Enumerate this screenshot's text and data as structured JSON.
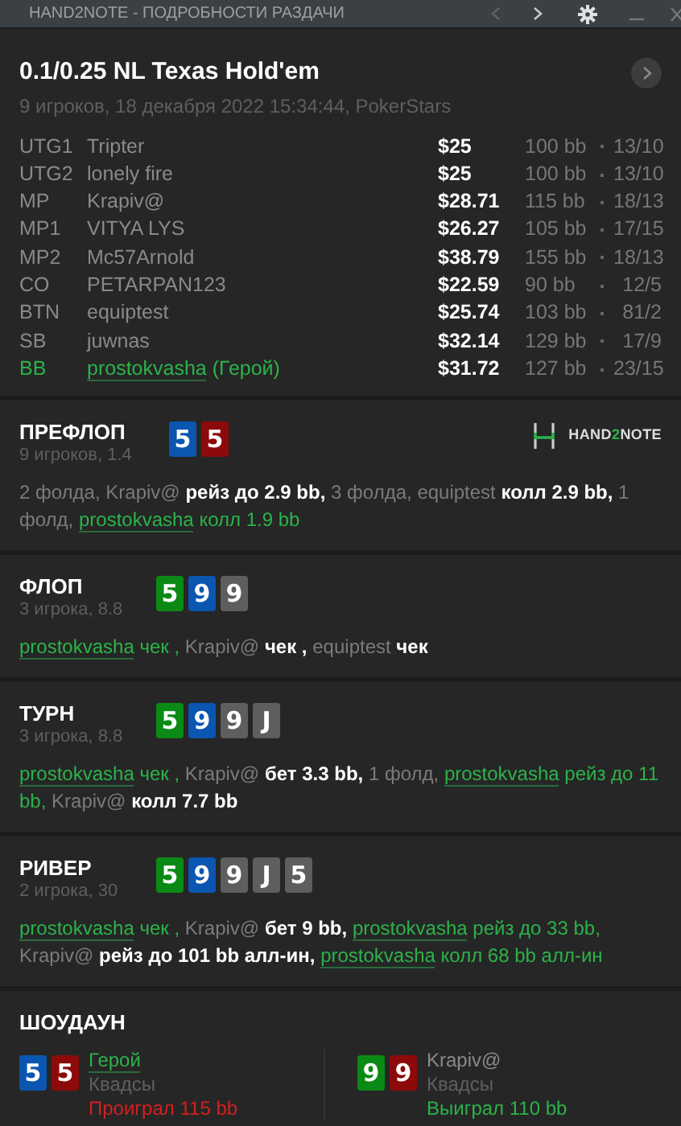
{
  "window": {
    "title": "HAND2NOTE - ПОДРОБНОСТИ РАЗДАЧИ",
    "back_disabled": true
  },
  "hand": {
    "title": "0.1/0.25 NL Texas Hold'em",
    "subtitle": "9 игроков, 18 декабря 2022 15:34:44, PokerStars"
  },
  "players": [
    {
      "position": "UTG1",
      "name": "Tripter",
      "hero": false,
      "stack": "$25",
      "bb": "100 bb",
      "stats": "13/10"
    },
    {
      "position": "UTG2",
      "name": "lonely fire",
      "hero": false,
      "stack": "$25",
      "bb": "100 bb",
      "stats": "13/10"
    },
    {
      "position": "MP",
      "name": "Krapiv@",
      "hero": false,
      "stack": "$28.71",
      "bb": "115 bb",
      "stats": "18/13"
    },
    {
      "position": "MP1",
      "name": "VITYA LYS",
      "hero": false,
      "stack": "$26.27",
      "bb": "105 bb",
      "stats": "17/15"
    },
    {
      "position": "MP2",
      "name": "Mc57Arnold",
      "hero": false,
      "stack": "$38.79",
      "bb": "155 bb",
      "stats": "18/13"
    },
    {
      "position": "CO",
      "name": "PETARPAN123",
      "hero": false,
      "stack": "$22.59",
      "bb": "90 bb",
      "stats": "12/5"
    },
    {
      "position": "BTN",
      "name": "equiptest",
      "hero": false,
      "stack": "$25.74",
      "bb": "103 bb",
      "stats": "81/2"
    },
    {
      "position": "SB",
      "name": "juwnas",
      "hero": false,
      "stack": "$32.14",
      "bb": "129 bb",
      "stats": "17/9"
    },
    {
      "position": "BB",
      "name": "prostokvasha",
      "hero": true,
      "hero_label": "(Герой)",
      "stack": "$31.72",
      "bb": "127 bb",
      "stats": "23/15"
    }
  ],
  "logo": {
    "text_a": "HAND",
    "text_b": "2",
    "text_c": "NOTE"
  },
  "streets": [
    {
      "name": "ПРЕФЛОП",
      "info": "9 игроков, 1.4",
      "cards": [
        {
          "rank": "5",
          "color": "#0b56b0"
        },
        {
          "rank": "5",
          "color": "#8c0a0a"
        }
      ],
      "actions": [
        {
          "kind": "plain",
          "text": "2 фолда,"
        },
        {
          "kind": "name",
          "text": "Krapiv@"
        },
        {
          "kind": "act",
          "text": "рейз до 2.9 bb,"
        },
        {
          "kind": "plain",
          "text": "3 фолда,"
        },
        {
          "kind": "name",
          "text": "equiptest"
        },
        {
          "kind": "act",
          "text": "колл 2.9 bb,"
        },
        {
          "kind": "plain",
          "text": "1 фолд,"
        },
        {
          "kind": "hero-name",
          "text": "prostokvasha"
        },
        {
          "kind": "hero-act",
          "text": "колл 1.9 bb"
        }
      ]
    },
    {
      "name": "ФЛОП",
      "info": "3 игрока, 8.8",
      "cards": [
        {
          "rank": "5",
          "color": "#0a8a14"
        },
        {
          "rank": "9",
          "color": "#0b56b0"
        },
        {
          "rank": "9",
          "color": "#5e5e5e"
        }
      ],
      "actions": [
        {
          "kind": "hero-name",
          "text": "prostokvasha"
        },
        {
          "kind": "hero-act",
          "text": "чек ,"
        },
        {
          "kind": "name",
          "text": "Krapiv@"
        },
        {
          "kind": "act",
          "text": "чек ,"
        },
        {
          "kind": "name",
          "text": "equiptest"
        },
        {
          "kind": "act",
          "text": "чек"
        }
      ]
    },
    {
      "name": "ТУРН",
      "info": "3 игрока, 8.8",
      "cards": [
        {
          "rank": "5",
          "color": "#0a8a14"
        },
        {
          "rank": "9",
          "color": "#0b56b0"
        },
        {
          "rank": "9",
          "color": "#5e5e5e"
        },
        {
          "rank": "J",
          "color": "#5e5e5e"
        }
      ],
      "actions": [
        {
          "kind": "hero-name",
          "text": "prostokvasha"
        },
        {
          "kind": "hero-act",
          "text": "чек ,"
        },
        {
          "kind": "name",
          "text": "Krapiv@"
        },
        {
          "kind": "act",
          "text": "бет 3.3 bb,"
        },
        {
          "kind": "plain",
          "text": "1 фолд,"
        },
        {
          "kind": "hero-name",
          "text": "prostokvasha"
        },
        {
          "kind": "hero-act",
          "text": "рейз до 11 bb,"
        },
        {
          "kind": "name",
          "text": "Krapiv@"
        },
        {
          "kind": "act",
          "text": "колл 7.7 bb"
        }
      ]
    },
    {
      "name": "РИВЕР",
      "info": "2 игрока, 30",
      "cards": [
        {
          "rank": "5",
          "color": "#0a8a14"
        },
        {
          "rank": "9",
          "color": "#0b56b0"
        },
        {
          "rank": "9",
          "color": "#5e5e5e"
        },
        {
          "rank": "J",
          "color": "#5e5e5e"
        },
        {
          "rank": "5",
          "color": "#5e5e5e"
        }
      ],
      "actions": [
        {
          "kind": "hero-name",
          "text": "prostokvasha"
        },
        {
          "kind": "hero-act",
          "text": "чек ,"
        },
        {
          "kind": "name",
          "text": "Krapiv@"
        },
        {
          "kind": "act",
          "text": "бет 9 bb,"
        },
        {
          "kind": "hero-name",
          "text": "prostokvasha"
        },
        {
          "kind": "hero-act",
          "text": "рейз до 33 bb,"
        },
        {
          "kind": "name",
          "text": "Krapiv@"
        },
        {
          "kind": "act",
          "text": "рейз до 101 bb алл-ин,"
        },
        {
          "kind": "hero-name",
          "text": "prostokvasha"
        },
        {
          "kind": "hero-act",
          "text": "колл 68 bb алл-ин"
        }
      ]
    }
  ],
  "showdown": {
    "title": "ШОУДАУН",
    "players": [
      {
        "name": "Герой",
        "hero": true,
        "hand": "Квадсы",
        "result": "Проиграл 115 bb",
        "won": false,
        "cards": [
          {
            "rank": "5",
            "color": "#0b56b0"
          },
          {
            "rank": "5",
            "color": "#8c0a0a"
          }
        ]
      },
      {
        "name": "Krapiv@",
        "hero": false,
        "hand": "Квадсы",
        "result": "Выиграл 110 bb",
        "won": true,
        "cards": [
          {
            "rank": "9",
            "color": "#0a8a14"
          },
          {
            "rank": "9",
            "color": "#8c0a0a"
          }
        ]
      }
    ]
  }
}
